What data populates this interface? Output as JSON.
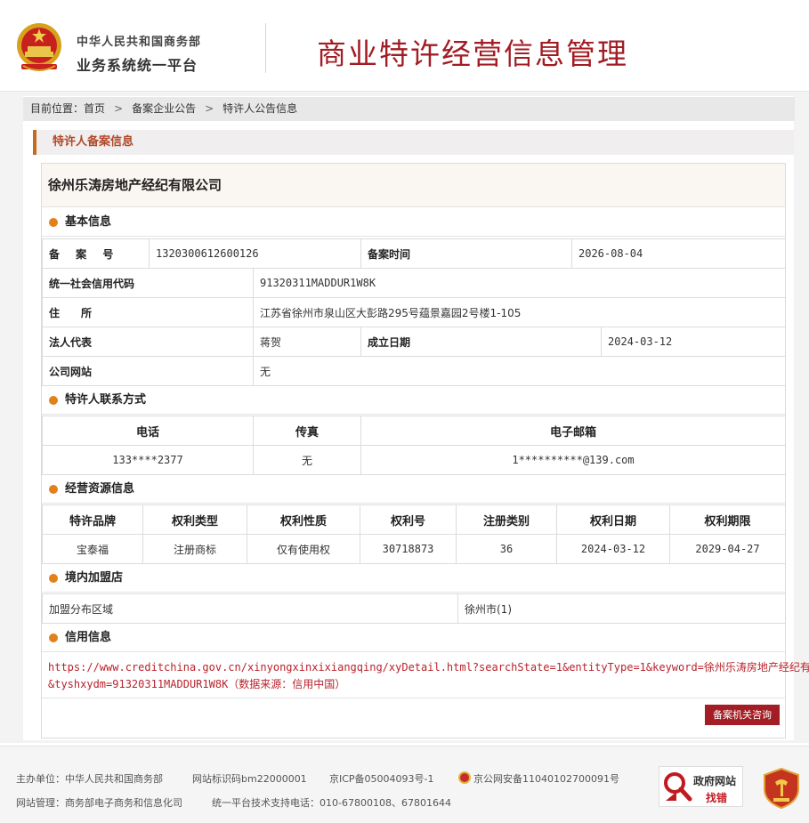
{
  "header": {
    "org_line1": "中华人民共和国商务部",
    "org_line2": "业务系统统一平台",
    "site_title": "商业特许经营信息管理"
  },
  "breadcrumb": {
    "prefix": "目前位置：",
    "items": [
      "首页",
      "备案企业公告",
      "特许人公告信息"
    ]
  },
  "section_title": "特许人备案信息",
  "company_name": "徐州乐涛房地产经纪有限公司",
  "basic": {
    "heading": "基本信息",
    "record_no_label": "备 案 号",
    "record_no": "1320300612600126",
    "record_time_label": "备案时间",
    "record_time": "2026-08-04",
    "credit_code_label": "统一社会信用代码",
    "credit_code": "91320311MADDUR1W8K",
    "address_label": "住　　所",
    "address": "江苏省徐州市泉山区大彭路295号蕴景嘉园2号楼1-105",
    "legal_rep_label": "法人代表",
    "legal_rep": "蒋贺",
    "founded_label": "成立日期",
    "founded": "2024-03-12",
    "website_label": "公司网站",
    "website": "无"
  },
  "contact": {
    "heading": "特许人联系方式",
    "columns": [
      "电话",
      "传真",
      "电子邮箱"
    ],
    "phone": "133****2377",
    "fax": "无",
    "email": "1**********@139.com"
  },
  "resources": {
    "heading": "经营资源信息",
    "columns": [
      "特许品牌",
      "权利类型",
      "权利性质",
      "权利号",
      "注册类别",
      "权利日期",
      "权利期限"
    ],
    "row": [
      "宝泰福",
      "注册商标",
      "仅有使用权",
      "30718873",
      "36",
      "2024-03-12",
      "2029-04-27"
    ]
  },
  "stores": {
    "heading": "境内加盟店",
    "region_label": "加盟分布区域",
    "region_value": "徐州市(1)"
  },
  "credit": {
    "heading": "信用信息",
    "line1": "https://www.creditchina.gov.cn/xinyongxinxixiangqing/xyDetail.html?searchState=1&entityType=1&keyword=徐州乐涛房地产经纪有限公司",
    "line2": "&tyshxydm=91320311MADDUR1W8K（数据来源：信用中国）"
  },
  "consult_button": "备案机关咨询",
  "footer": {
    "sponsor": "主办单位：中华人民共和国商务部",
    "site_code": "网站标识码bm22000001",
    "icp": "京ICP备05004093号-1",
    "police": "京公网安备11040102700091号",
    "manager": "网站管理：商务部电子商务和信息化司",
    "support": "统一平台技术支持电话：010-67800108、67801644",
    "gov_badge_line1": "政府网站",
    "gov_badge_line2": "找错"
  },
  "colors": {
    "brand_red": "#a21c23",
    "accent_orange": "#e2801a",
    "section_border": "#c86a1c"
  }
}
